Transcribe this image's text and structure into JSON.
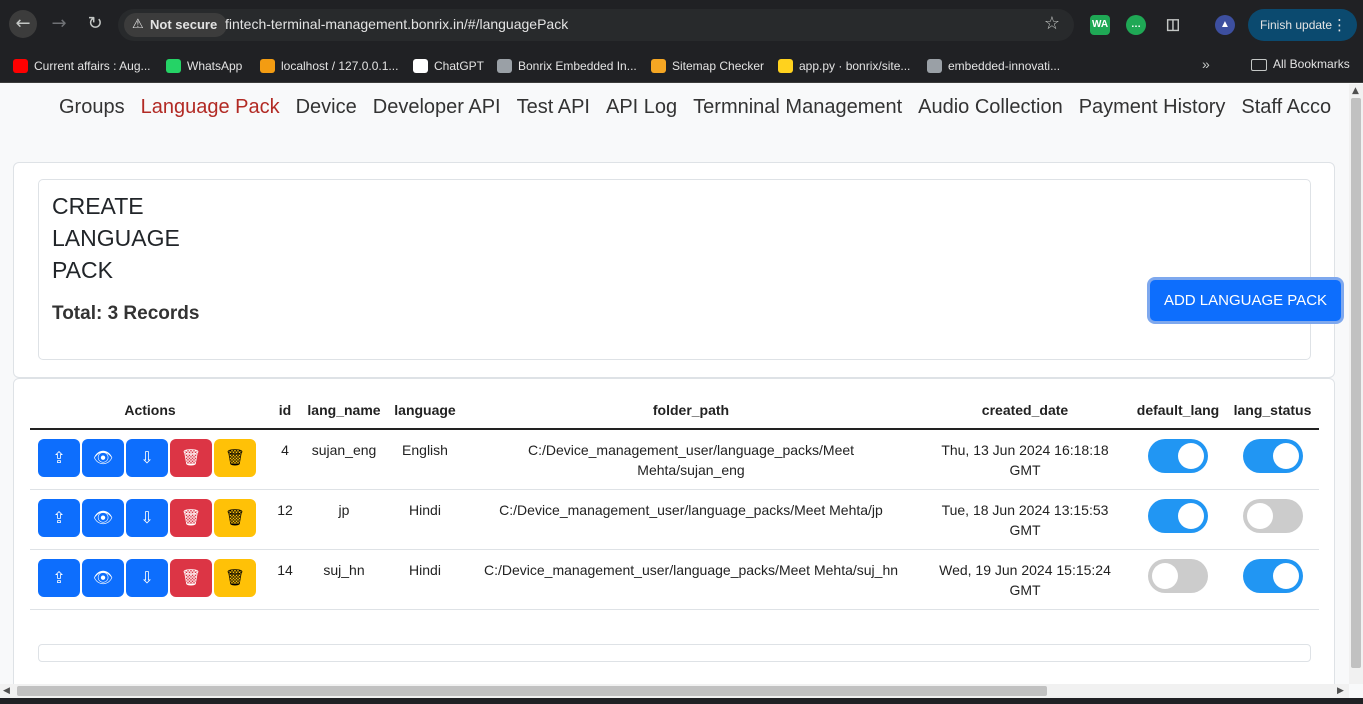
{
  "browser": {
    "security_label": "Not secure",
    "url": "fintech-terminal-management.bonrix.in/#/languagePack",
    "finish_update": "Finish update",
    "all_bookmarks": "All Bookmarks",
    "bookmarks": [
      {
        "label": "Current affairs : Aug...",
        "color": "#ff0000"
      },
      {
        "label": "WhatsApp",
        "color": "#25d366"
      },
      {
        "label": "localhost / 127.0.0.1...",
        "color": "#f39c12"
      },
      {
        "label": "ChatGPT",
        "color": "#ffffff"
      },
      {
        "label": "Bonrix Embedded In...",
        "color": "#9aa0a6"
      },
      {
        "label": "Sitemap Checker",
        "color": "#f5a623"
      },
      {
        "label": "app.py · bonrix/site...",
        "color": "#ffd21e"
      },
      {
        "label": "embedded-innovati...",
        "color": "#9aa0a6"
      }
    ]
  },
  "nav": {
    "items": [
      "Groups",
      "Language Pack",
      "Device",
      "Developer API",
      "Test API",
      "API Log",
      "Termninal Management",
      "Audio Collection",
      "Payment History",
      "Staff Acco"
    ],
    "active_index": 1
  },
  "header": {
    "title_lines": [
      "CREATE",
      "LANGUAGE",
      "PACK"
    ],
    "total": "Total: 3 Records",
    "add_button": "ADD LANGUAGE PACK"
  },
  "table": {
    "columns": [
      "Actions",
      "id",
      "lang_name",
      "language",
      "folder_path",
      "created_date",
      "default_lang",
      "lang_status"
    ],
    "rows": [
      {
        "id": "4",
        "lang_name": "sujan_eng",
        "language": "English",
        "folder_path": "C:/Device_management_user/language_packs/Meet Mehta/sujan_eng",
        "created_date": "Thu, 13 Jun 2024 16:18:18 GMT",
        "default_lang": true,
        "lang_status": true
      },
      {
        "id": "12",
        "lang_name": "jp",
        "language": "Hindi",
        "folder_path": "C:/Device_management_user/language_packs/Meet Mehta/jp",
        "created_date": "Tue, 18 Jun 2024 13:15:53 GMT",
        "default_lang": true,
        "lang_status": false
      },
      {
        "id": "14",
        "lang_name": "suj_hn",
        "language": "Hindi",
        "folder_path": "C:/Device_management_user/language_packs/Meet Mehta/suj_hn",
        "created_date": "Wed, 19 Jun 2024 15:15:24 GMT",
        "default_lang": false,
        "lang_status": true
      }
    ]
  },
  "colors": {
    "primary": "#0d6efd",
    "danger": "#dc3545",
    "warning": "#ffc107",
    "toggle_on": "#2196f3",
    "active_nav": "#b22a24"
  }
}
